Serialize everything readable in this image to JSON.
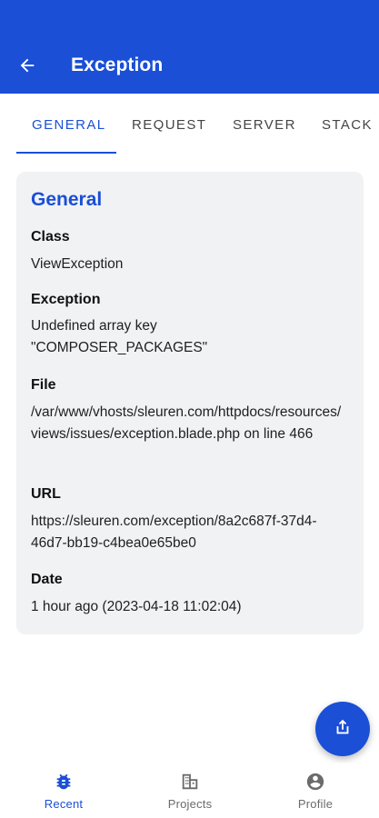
{
  "appbar": {
    "title": "Exception",
    "back_icon": "arrow-left-icon",
    "background_color": "#1a4fd6"
  },
  "tabs": [
    {
      "label": "GENERAL",
      "active": true
    },
    {
      "label": "REQUEST",
      "active": false
    },
    {
      "label": "SERVER",
      "active": false
    },
    {
      "label": "STACK",
      "active": false
    }
  ],
  "general": {
    "title": "General",
    "fields": [
      {
        "label": "Class",
        "value": "ViewException"
      },
      {
        "label": "Exception",
        "value": "Undefined array key \"COMPOSER_PACKAGES\""
      },
      {
        "label": "File",
        "value": "/var/www/vhosts/sleuren.com/httpdocs/resources/views/issues/exception.blade.php on line 466"
      },
      {
        "label": "URL",
        "value": "https://sleuren.com/exception/8a2c687f-37d4-46d7-bb19-c4bea0e65be0"
      },
      {
        "label": "Date",
        "value": "1 hour ago (2023-04-18 11:02:04)"
      }
    ]
  },
  "fab": {
    "icon": "share-icon"
  },
  "bottom_nav": [
    {
      "label": "Recent",
      "icon": "bug-icon",
      "active": true
    },
    {
      "label": "Projects",
      "icon": "buildings-icon",
      "active": false
    },
    {
      "label": "Profile",
      "icon": "account-circle-icon",
      "active": false
    }
  ]
}
